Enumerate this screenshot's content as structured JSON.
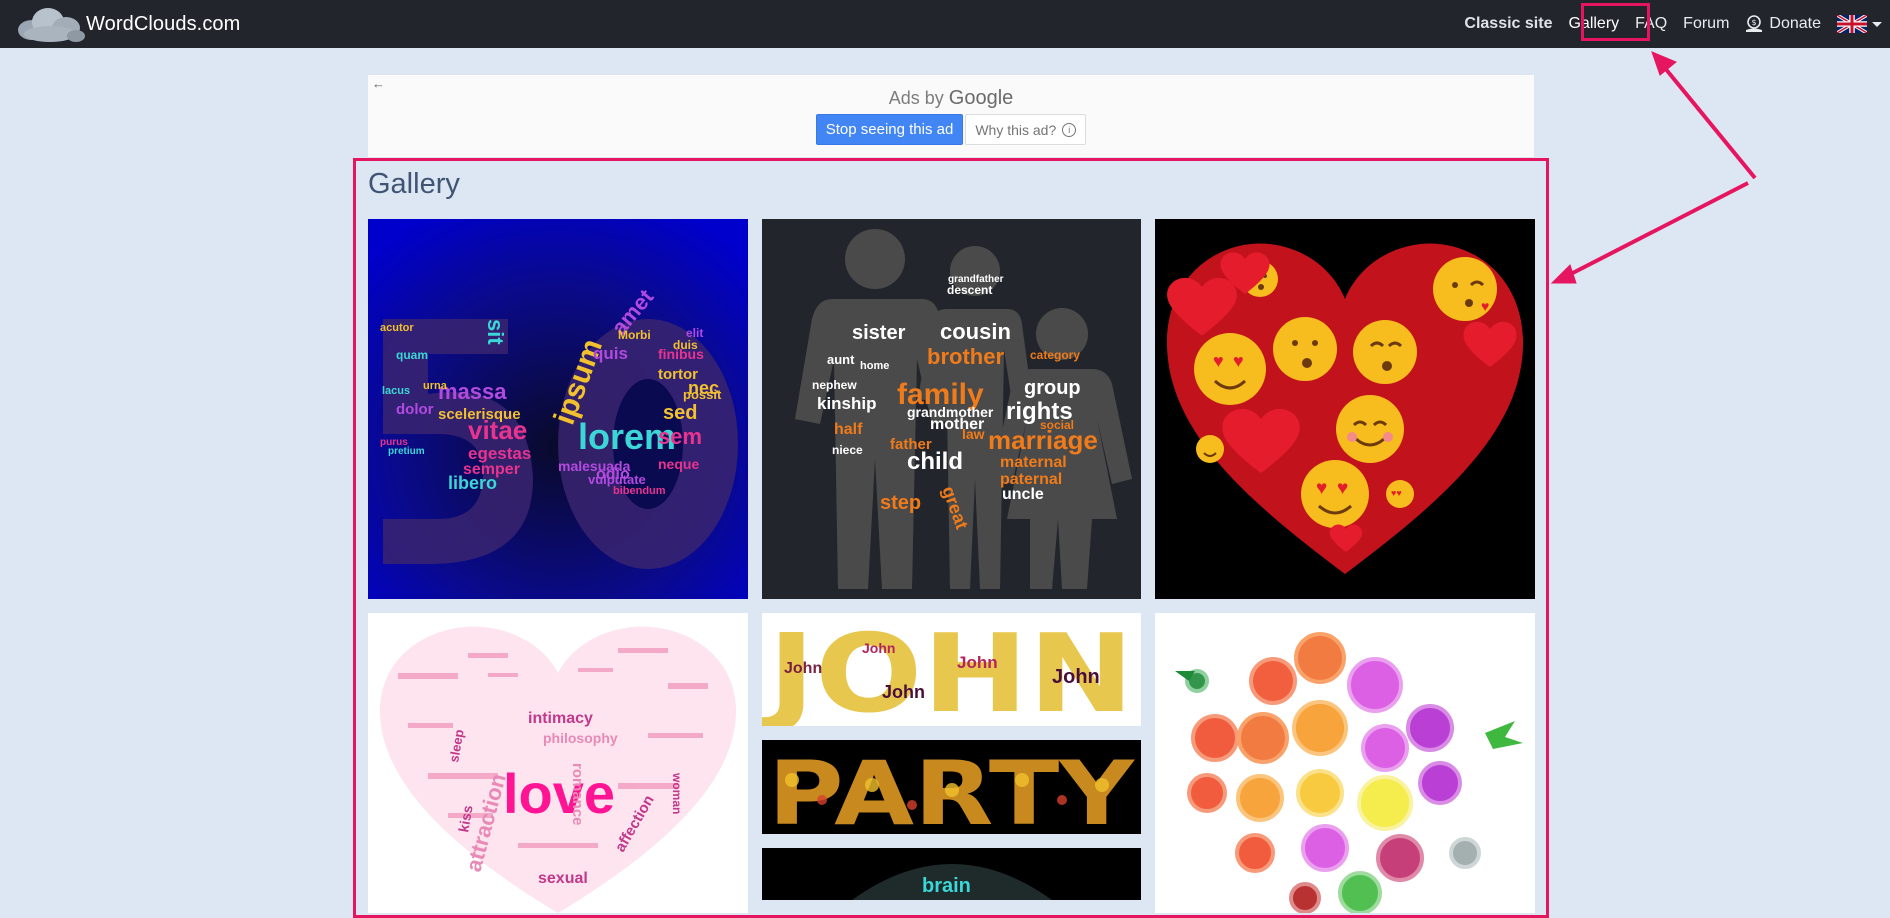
{
  "navbar": {
    "brand": "WordClouds.com",
    "links": {
      "classic": "Classic site",
      "gallery": "Gallery",
      "faq": "FAQ",
      "forum": "Forum",
      "donate": "Donate"
    },
    "language_icon": "uk-flag-icon"
  },
  "ad": {
    "back_icon": "←",
    "label_prefix": "Ads by",
    "label_brand": "Google",
    "stop_button": "Stop seeing this ad",
    "why_button": "Why this ad?",
    "info_icon": "i"
  },
  "gallery": {
    "title": "Gallery",
    "tiles": [
      {
        "name": "tile-50",
        "words": [
          "lorem",
          "ipsum",
          "vitae",
          "sed",
          "massa",
          "sit",
          "amet",
          "libero",
          "egestas",
          "semper",
          "dolor",
          "quis",
          "odio",
          "sem",
          "nec",
          "tortor",
          "possit",
          "neque",
          "finibus",
          "Morbi",
          "duis",
          "elit",
          "malesuada",
          "vulputate",
          "bibendum",
          "scelerisque",
          "urna",
          "acutor",
          "pretium",
          "purus",
          "lacus",
          "quam"
        ]
      },
      {
        "name": "tile-family",
        "words": [
          "family",
          "brother",
          "cousin",
          "marriage",
          "rights",
          "child",
          "sister",
          "mother",
          "father",
          "kinship",
          "group",
          "uncle",
          "grandmother",
          "step",
          "maternal",
          "paternal",
          "niece",
          "nephew",
          "aunt",
          "law",
          "home",
          "descent",
          "grandfather",
          "social",
          "category",
          "half",
          "great"
        ]
      },
      {
        "name": "tile-emoji-heart"
      },
      {
        "name": "tile-love",
        "words": [
          "love",
          "attraction",
          "intimacy",
          "philosophy",
          "kiss",
          "sexual",
          "affection",
          "woman",
          "sleep",
          "romance"
        ]
      },
      {
        "name": "tile-john",
        "words": [
          "JOHN",
          "John"
        ]
      },
      {
        "name": "tile-party",
        "words": [
          "PARTY"
        ]
      },
      {
        "name": "tile-brain",
        "words": [
          "brain"
        ]
      },
      {
        "name": "tile-circles-bird"
      }
    ]
  },
  "colors": {
    "navbar_bg": "#22262c",
    "page_bg": "#dde6f3",
    "highlight": "#e6155f",
    "ad_button": "#4285f4"
  }
}
